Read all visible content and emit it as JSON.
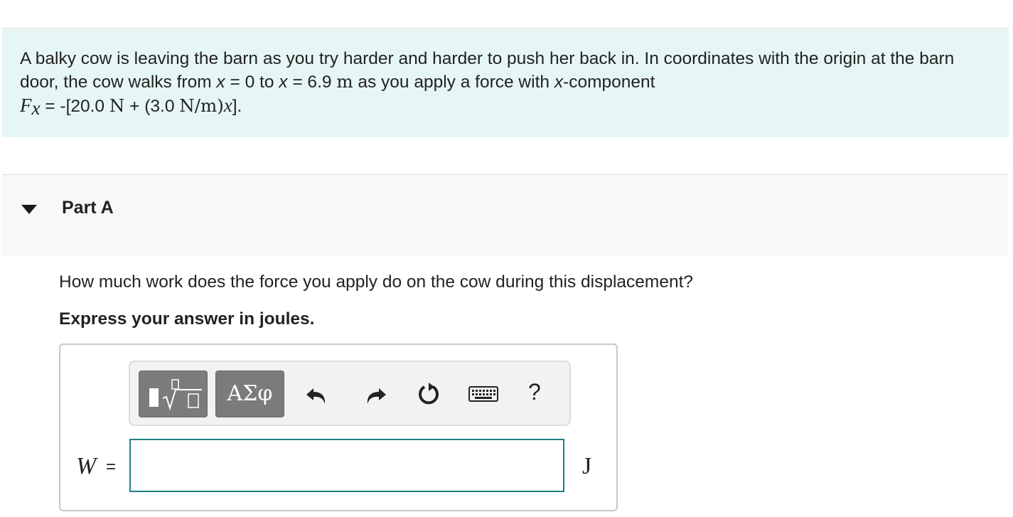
{
  "problem": {
    "p1": "A balky cow is leaving the barn as you try harder and harder to push her back in. In coordinates with the origin at the barn door, the cow walks from ",
    "x_var": "x",
    "eq_zero": " = 0 to ",
    "eq_dist": " = 6.9 ",
    "unit_m": "m",
    "p2": " as you apply a force with ",
    "p3": "-component",
    "force_F": "F",
    "force_sub": "x",
    "f1": " = -[20.0 ",
    "unit_N": "N",
    "f2": " + (3.0 ",
    "unit_Npm": "N/m)",
    "f3": "]."
  },
  "part": {
    "title": "Part A"
  },
  "question": {
    "text": "How much work does the force you apply do on the cow during this displacement?",
    "instruction": "Express your answer in joules."
  },
  "toolbar": {
    "greek_label": "ΑΣφ",
    "help_label": "?",
    "icons": [
      "templates-icon",
      "undo-icon",
      "redo-icon",
      "reset-icon",
      "keyboard-icon",
      "help-icon"
    ]
  },
  "answer": {
    "variable": "W",
    "equals": "=",
    "value": "",
    "unit": "J"
  },
  "colors": {
    "problem_bg": "#e6f6f5",
    "input_border": "#1f7f86",
    "toolbar_button": "#7b7b7b"
  }
}
